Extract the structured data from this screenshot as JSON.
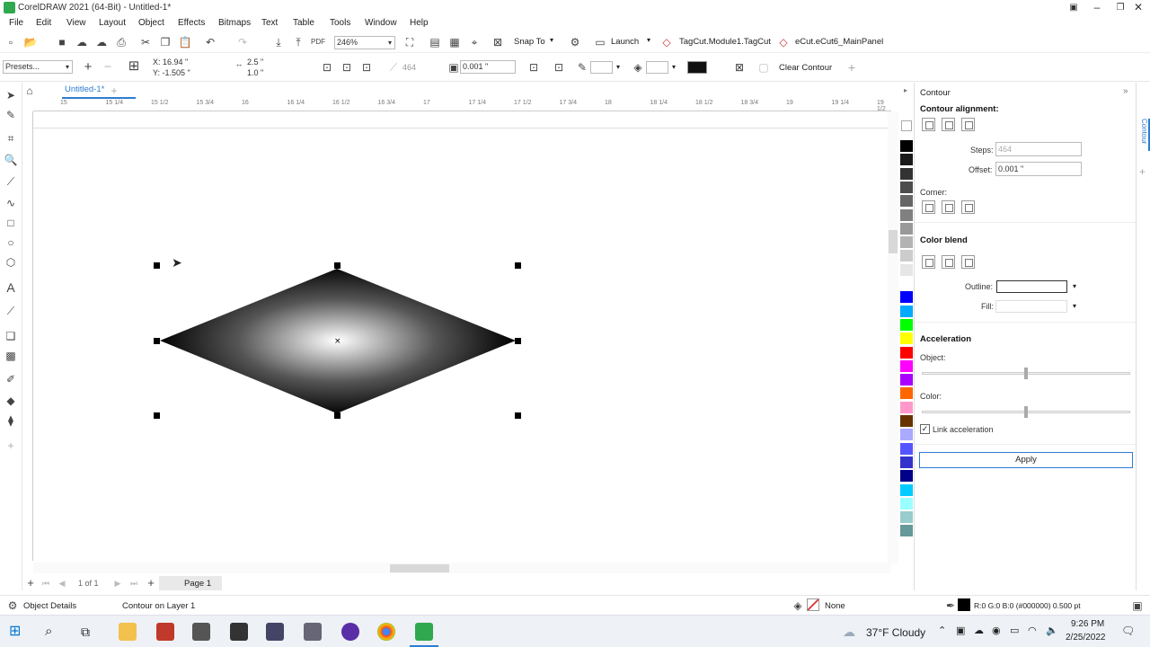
{
  "window": {
    "title": "CorelDRAW 2021 (64-Bit) - Untitled-1*"
  },
  "menu": [
    "File",
    "Edit",
    "View",
    "Layout",
    "Object",
    "Effects",
    "Bitmaps",
    "Text",
    "Table",
    "Tools",
    "Window",
    "Help"
  ],
  "standard_toolbar": {
    "zoom": "246%",
    "snap_to": "Snap To",
    "launch": "Launch",
    "macro1": "TagCut.Module1.TagCut",
    "macro2": "eCut.eCut6_MainPanel"
  },
  "property_bar": {
    "presets": "Presets...",
    "x": "X: 16.94 \"",
    "y": "Y: -1.505 \"",
    "w": "2.5 \"",
    "h": "1.0 \"",
    "steps": "464",
    "offset": "0.001 \"",
    "clear_contour": "Clear Contour"
  },
  "document_tab": "Untitled-1*",
  "ruler_labels": [
    "15",
    "15 1/4",
    "15 1/2",
    "15 3/4",
    "16",
    "16 1/4",
    "16 1/2",
    "16 3/4",
    "17",
    "17 1/4",
    "17 1/2",
    "17 3/4",
    "18",
    "18 1/4",
    "18 1/2",
    "18 3/4",
    "19",
    "19 1/4",
    "19 1/2"
  ],
  "pager": {
    "count": "1 of 1",
    "page_tab": "Page 1"
  },
  "docker": {
    "title": "Contour",
    "tab_label": "Contour",
    "alignment_label": "Contour alignment:",
    "steps_label": "Steps:",
    "steps_value": "464",
    "offset_label": "Offset:",
    "offset_value": "0.001 \"",
    "corner_label": "Corner:",
    "color_blend_label": "Color blend",
    "outline_label": "Outline:",
    "fill_label": "Fill:",
    "acceleration_label": "Acceleration",
    "object_label": "Object:",
    "color_label": "Color:",
    "link_accel_label": "Link acceleration",
    "link_accel_checked": true,
    "object_accel": 0.5,
    "color_accel": 0.5,
    "apply_label": "Apply"
  },
  "palette": [
    "#ffffff",
    "#000000",
    "#1a1a1a",
    "#333333",
    "#4d4d4d",
    "#666666",
    "#808080",
    "#999999",
    "#b3b3b3",
    "#cccccc",
    "#e6e6e6",
    "#ffffff",
    "#0000ff",
    "#00aaff",
    "#00ff00",
    "#ffff00",
    "#ff0000",
    "#ff00ff",
    "#aa00ff",
    "#ff6600",
    "#ff99cc",
    "#663300",
    "#aaaaff",
    "#5555ff",
    "#3333cc",
    "#000088",
    "#00ccff",
    "#99ffff",
    "#99cccc",
    "#669999"
  ],
  "status": {
    "object_details": "Object Details",
    "layer_info": "Contour on Layer 1",
    "fill_none": "None",
    "outline_info": "R:0 G:0 B:0 (#000000)  0.500 pt"
  },
  "taskbar": {
    "weather": "37°F  Cloudy",
    "time": "9:26 PM",
    "date": "2/25/2022"
  },
  "colors": {
    "accent": "#2d7dd2",
    "corel_green": "#2fa84f"
  }
}
